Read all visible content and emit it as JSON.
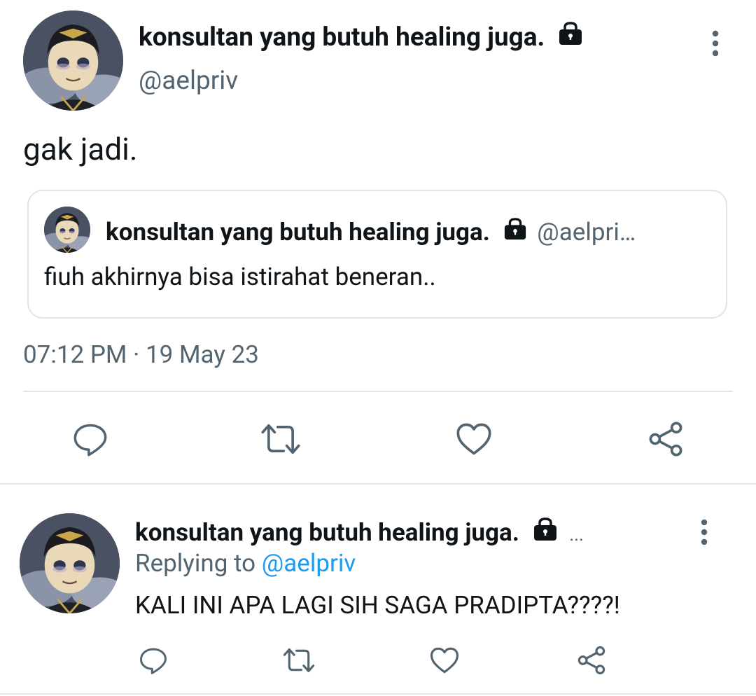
{
  "main_tweet": {
    "display_name": "konsultan yang butuh healing juga.",
    "handle": "@aelpriv",
    "text": "gak jadi.",
    "timestamp": "07:12 PM · 19 May 23",
    "quoted": {
      "display_name": "konsultan yang butuh healing juga.",
      "handle": "@aelpri…",
      "text": "fiuh akhirnya bisa istirahat beneran.."
    }
  },
  "reply": {
    "display_name": "konsultan yang butuh healing juga.",
    "more_dots": "...",
    "replying_prefix": "Replying to",
    "replying_handle": "@aelpriv",
    "text": "KALI INI APA LAGI SIH SAGA PRADIPTA????!"
  },
  "icons": [
    "lock-icon",
    "more-vertical-icon",
    "reply-icon",
    "retweet-icon",
    "like-icon",
    "share-icon"
  ],
  "colors": {
    "text": "#0f1419",
    "muted": "#536471",
    "link": "#1d9bf0",
    "divider": "#e1e4e8"
  }
}
